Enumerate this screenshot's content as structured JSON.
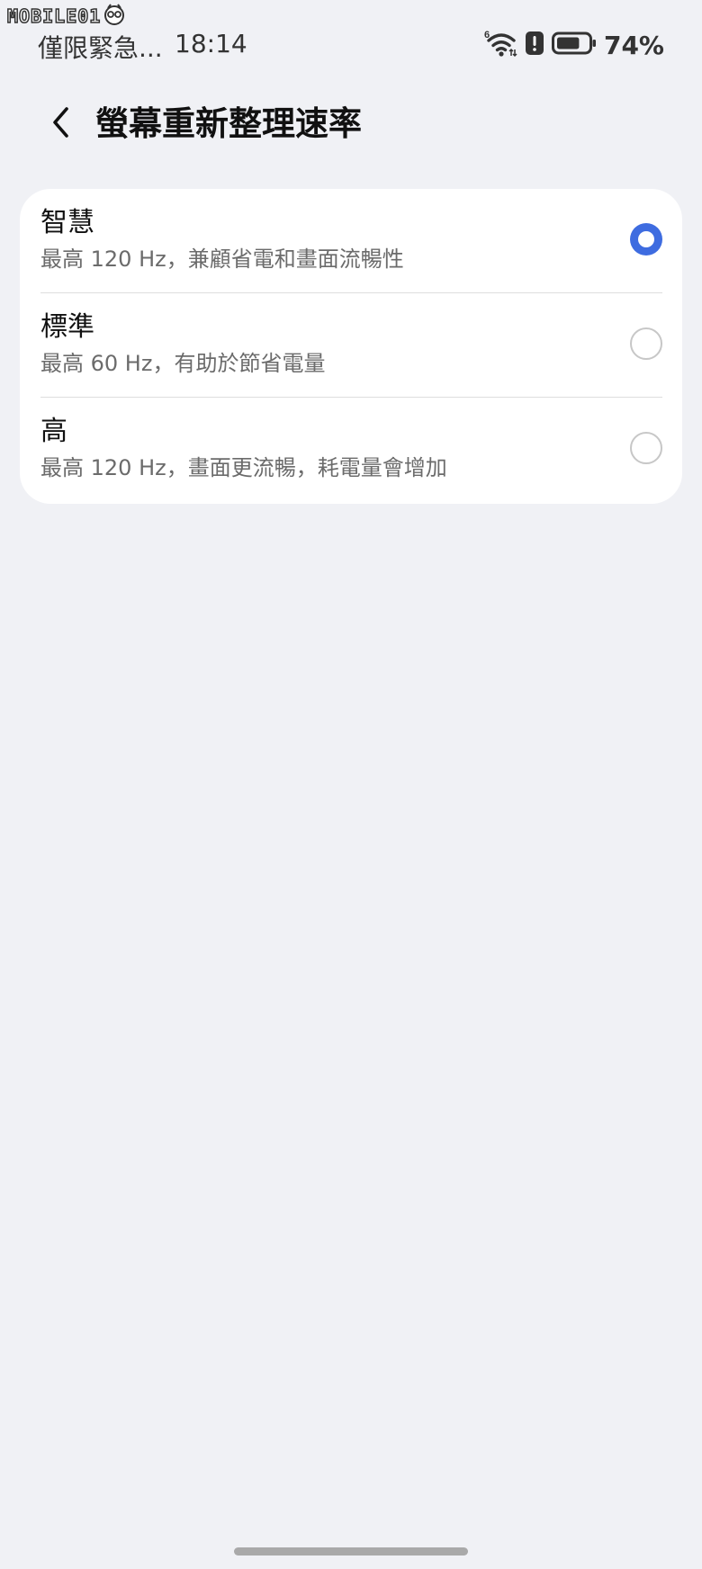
{
  "watermark": {
    "text": "MOBILE01",
    "icon": "owl-logo-icon"
  },
  "status_bar": {
    "carrier": "僅限緊急...",
    "time": "18:14",
    "wifi_badge": "6",
    "icons": [
      "wifi-6-icon",
      "alert-icon",
      "battery-icon"
    ],
    "battery_percent": "74%",
    "battery_level": 0.74
  },
  "header": {
    "back_icon": "chevron-left-icon",
    "title": "螢幕重新整理速率"
  },
  "options": [
    {
      "title": "智慧",
      "description": "最高 120 Hz，兼顧省電和畫面流暢性",
      "selected": true
    },
    {
      "title": "標準",
      "description": "最高 60 Hz，有助於節省電量",
      "selected": false
    },
    {
      "title": "高",
      "description": "最高 120 Hz，畫面更流暢，耗電量會增加",
      "selected": false
    }
  ],
  "colors": {
    "background": "#f0f1f5",
    "card": "#ffffff",
    "accent": "#3e6ce0",
    "radio_border": "#c7c7c7"
  }
}
